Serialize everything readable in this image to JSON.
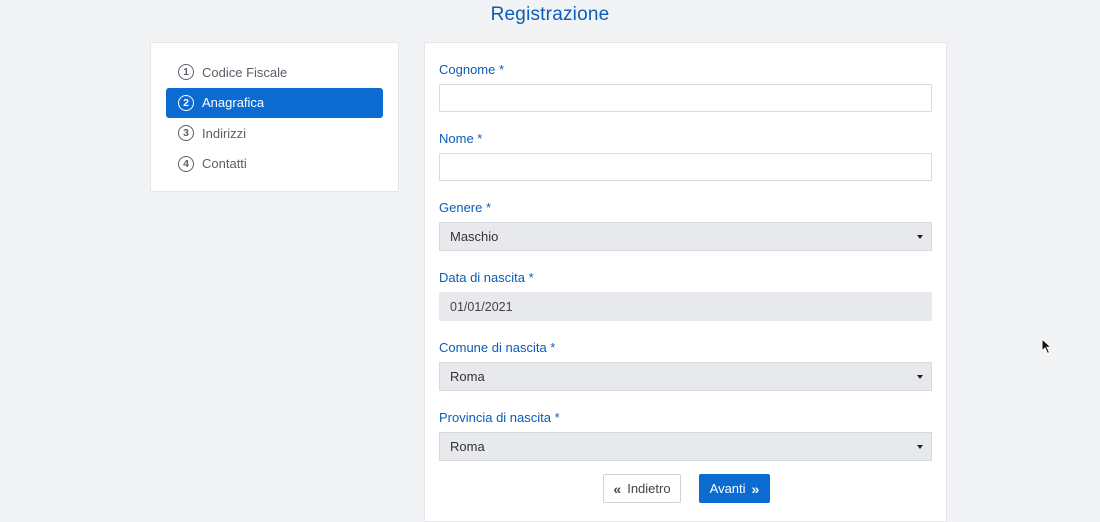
{
  "page": {
    "title": "Registrazione"
  },
  "steps": [
    {
      "number": "1",
      "label": "Codice Fiscale",
      "active": false
    },
    {
      "number": "2",
      "label": "Anagrafica",
      "active": true
    },
    {
      "number": "3",
      "label": "Indirizzi",
      "active": false
    },
    {
      "number": "4",
      "label": "Contatti",
      "active": false
    }
  ],
  "form": {
    "cognome": {
      "label": "Cognome *",
      "value": ""
    },
    "nome": {
      "label": "Nome *",
      "value": ""
    },
    "genere": {
      "label": "Genere *",
      "value": "Maschio"
    },
    "data_nascita": {
      "label": "Data di nascita *",
      "value": "01/01/2021"
    },
    "comune_nascita": {
      "label": "Comune di nascita *",
      "value": "Roma"
    },
    "provincia_nascita": {
      "label": "Provincia di nascita *",
      "value": "Roma"
    }
  },
  "buttons": {
    "back": {
      "label": "Indietro",
      "icon": "chevron-double-left-icon"
    },
    "next": {
      "label": "Avanti",
      "icon": "chevron-double-right-icon"
    }
  },
  "colors": {
    "accent": "#0b6bd1",
    "label": "#0a5db8",
    "background": "#f2f3f5"
  }
}
